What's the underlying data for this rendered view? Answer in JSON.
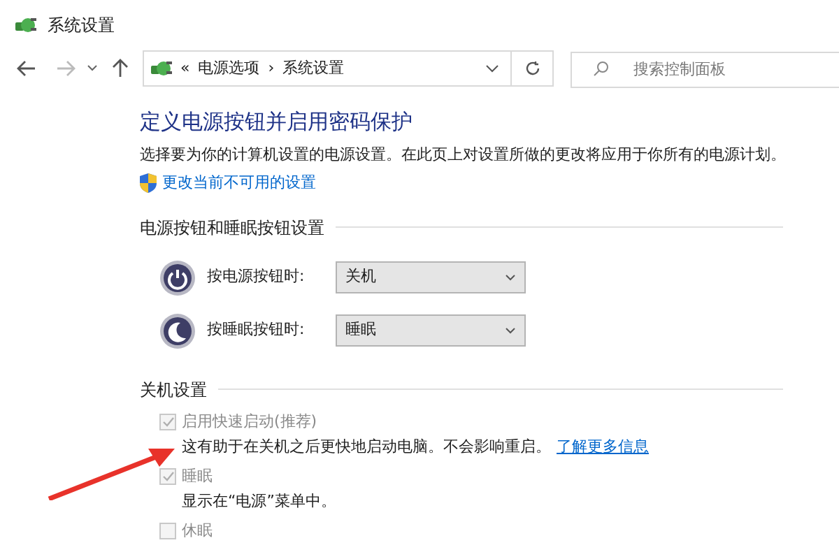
{
  "window": {
    "title": "系统设置"
  },
  "address_bar": {
    "crumbs": [
      "«",
      "电源选项",
      "›",
      "系统设置"
    ]
  },
  "search": {
    "placeholder": "搜索控制面板"
  },
  "heading": "定义电源按钮并启用密码保护",
  "description": "选择要为你的计算机设置的电源设置。在此页上对设置所做的更改将应用于你所有的电源计划。",
  "admin_link": "更改当前不可用的设置",
  "button_section": {
    "title": "电源按钮和睡眠按钮设置",
    "rows": [
      {
        "kind": "power",
        "label": "按电源按钮时:",
        "value": "关机"
      },
      {
        "kind": "sleep",
        "label": "按睡眠按钮时:",
        "value": "睡眠"
      }
    ]
  },
  "shutdown_section": {
    "title": "关机设置",
    "options": [
      {
        "label": "启用快速启动(推荐)",
        "checked": true,
        "disabled": true,
        "note": "这有助于在关机之后更快地启动电脑。不会影响重启。",
        "link": "了解更多信息"
      },
      {
        "label": "睡眠",
        "checked": true,
        "disabled": true,
        "note": "显示在“电源”菜单中。"
      },
      {
        "label": "休眠",
        "checked": false,
        "disabled": true
      }
    ]
  }
}
